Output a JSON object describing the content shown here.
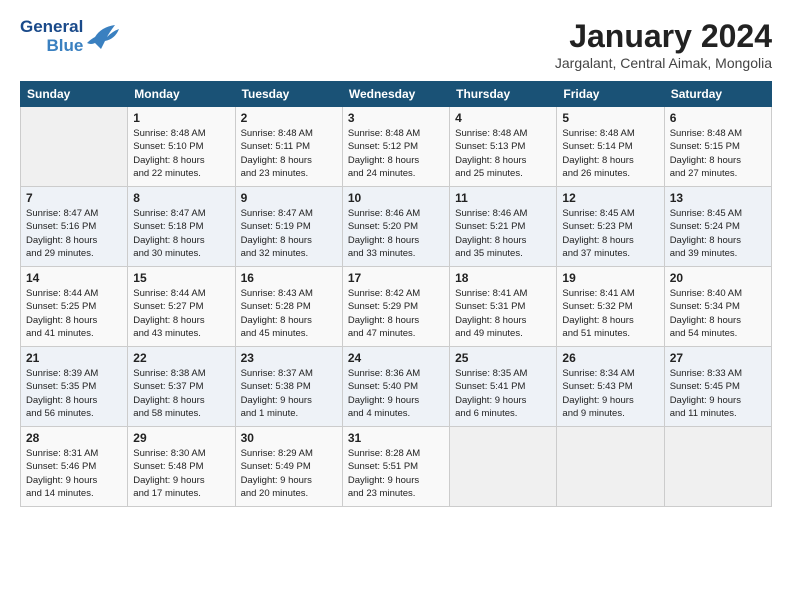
{
  "header": {
    "logo_line1": "General",
    "logo_line2": "Blue",
    "month_title": "January 2024",
    "subtitle": "Jargalant, Central Aimak, Mongolia"
  },
  "weekdays": [
    "Sunday",
    "Monday",
    "Tuesday",
    "Wednesday",
    "Thursday",
    "Friday",
    "Saturday"
  ],
  "weeks": [
    [
      {
        "day": "",
        "info": ""
      },
      {
        "day": "1",
        "info": "Sunrise: 8:48 AM\nSunset: 5:10 PM\nDaylight: 8 hours\nand 22 minutes."
      },
      {
        "day": "2",
        "info": "Sunrise: 8:48 AM\nSunset: 5:11 PM\nDaylight: 8 hours\nand 23 minutes."
      },
      {
        "day": "3",
        "info": "Sunrise: 8:48 AM\nSunset: 5:12 PM\nDaylight: 8 hours\nand 24 minutes."
      },
      {
        "day": "4",
        "info": "Sunrise: 8:48 AM\nSunset: 5:13 PM\nDaylight: 8 hours\nand 25 minutes."
      },
      {
        "day": "5",
        "info": "Sunrise: 8:48 AM\nSunset: 5:14 PM\nDaylight: 8 hours\nand 26 minutes."
      },
      {
        "day": "6",
        "info": "Sunrise: 8:48 AM\nSunset: 5:15 PM\nDaylight: 8 hours\nand 27 minutes."
      }
    ],
    [
      {
        "day": "7",
        "info": "Sunrise: 8:47 AM\nSunset: 5:16 PM\nDaylight: 8 hours\nand 29 minutes."
      },
      {
        "day": "8",
        "info": "Sunrise: 8:47 AM\nSunset: 5:18 PM\nDaylight: 8 hours\nand 30 minutes."
      },
      {
        "day": "9",
        "info": "Sunrise: 8:47 AM\nSunset: 5:19 PM\nDaylight: 8 hours\nand 32 minutes."
      },
      {
        "day": "10",
        "info": "Sunrise: 8:46 AM\nSunset: 5:20 PM\nDaylight: 8 hours\nand 33 minutes."
      },
      {
        "day": "11",
        "info": "Sunrise: 8:46 AM\nSunset: 5:21 PM\nDaylight: 8 hours\nand 35 minutes."
      },
      {
        "day": "12",
        "info": "Sunrise: 8:45 AM\nSunset: 5:23 PM\nDaylight: 8 hours\nand 37 minutes."
      },
      {
        "day": "13",
        "info": "Sunrise: 8:45 AM\nSunset: 5:24 PM\nDaylight: 8 hours\nand 39 minutes."
      }
    ],
    [
      {
        "day": "14",
        "info": "Sunrise: 8:44 AM\nSunset: 5:25 PM\nDaylight: 8 hours\nand 41 minutes."
      },
      {
        "day": "15",
        "info": "Sunrise: 8:44 AM\nSunset: 5:27 PM\nDaylight: 8 hours\nand 43 minutes."
      },
      {
        "day": "16",
        "info": "Sunrise: 8:43 AM\nSunset: 5:28 PM\nDaylight: 8 hours\nand 45 minutes."
      },
      {
        "day": "17",
        "info": "Sunrise: 8:42 AM\nSunset: 5:29 PM\nDaylight: 8 hours\nand 47 minutes."
      },
      {
        "day": "18",
        "info": "Sunrise: 8:41 AM\nSunset: 5:31 PM\nDaylight: 8 hours\nand 49 minutes."
      },
      {
        "day": "19",
        "info": "Sunrise: 8:41 AM\nSunset: 5:32 PM\nDaylight: 8 hours\nand 51 minutes."
      },
      {
        "day": "20",
        "info": "Sunrise: 8:40 AM\nSunset: 5:34 PM\nDaylight: 8 hours\nand 54 minutes."
      }
    ],
    [
      {
        "day": "21",
        "info": "Sunrise: 8:39 AM\nSunset: 5:35 PM\nDaylight: 8 hours\nand 56 minutes."
      },
      {
        "day": "22",
        "info": "Sunrise: 8:38 AM\nSunset: 5:37 PM\nDaylight: 8 hours\nand 58 minutes."
      },
      {
        "day": "23",
        "info": "Sunrise: 8:37 AM\nSunset: 5:38 PM\nDaylight: 9 hours\nand 1 minute."
      },
      {
        "day": "24",
        "info": "Sunrise: 8:36 AM\nSunset: 5:40 PM\nDaylight: 9 hours\nand 4 minutes."
      },
      {
        "day": "25",
        "info": "Sunrise: 8:35 AM\nSunset: 5:41 PM\nDaylight: 9 hours\nand 6 minutes."
      },
      {
        "day": "26",
        "info": "Sunrise: 8:34 AM\nSunset: 5:43 PM\nDaylight: 9 hours\nand 9 minutes."
      },
      {
        "day": "27",
        "info": "Sunrise: 8:33 AM\nSunset: 5:45 PM\nDaylight: 9 hours\nand 11 minutes."
      }
    ],
    [
      {
        "day": "28",
        "info": "Sunrise: 8:31 AM\nSunset: 5:46 PM\nDaylight: 9 hours\nand 14 minutes."
      },
      {
        "day": "29",
        "info": "Sunrise: 8:30 AM\nSunset: 5:48 PM\nDaylight: 9 hours\nand 17 minutes."
      },
      {
        "day": "30",
        "info": "Sunrise: 8:29 AM\nSunset: 5:49 PM\nDaylight: 9 hours\nand 20 minutes."
      },
      {
        "day": "31",
        "info": "Sunrise: 8:28 AM\nSunset: 5:51 PM\nDaylight: 9 hours\nand 23 minutes."
      },
      {
        "day": "",
        "info": ""
      },
      {
        "day": "",
        "info": ""
      },
      {
        "day": "",
        "info": ""
      }
    ]
  ]
}
